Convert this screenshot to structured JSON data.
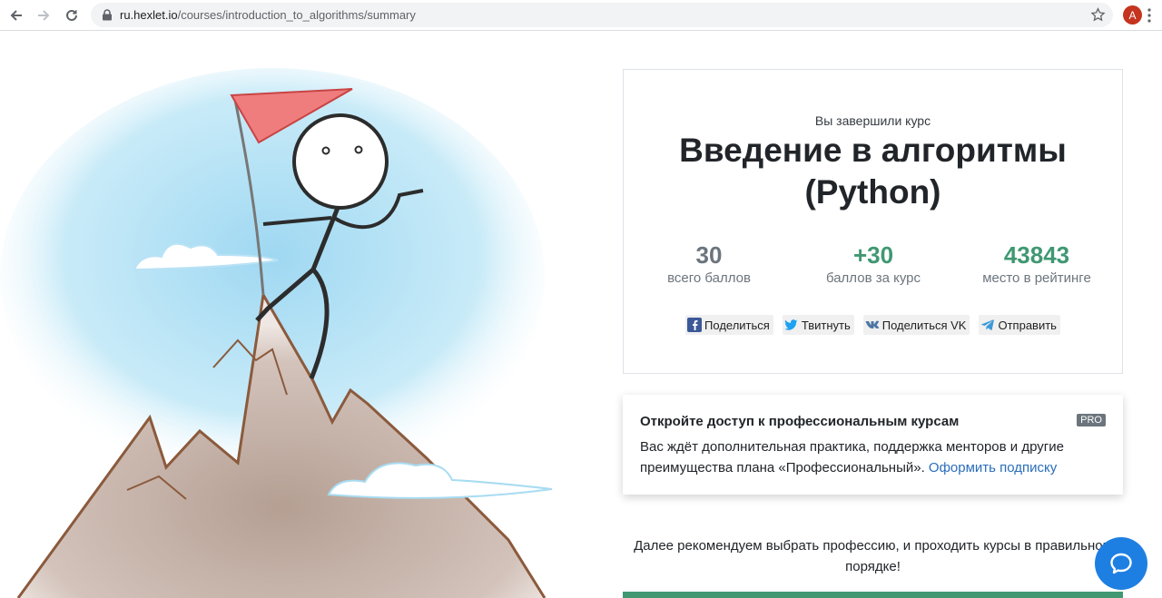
{
  "browser": {
    "url_host": "ru.hexlet.io",
    "url_path": "/courses/introduction_to_algorithms/summary",
    "avatar_letter": "A"
  },
  "summary": {
    "completed_label": "Вы завершили курс",
    "course_title": "Введение в алгоритмы (Python)",
    "stats": [
      {
        "value": "30",
        "label": "всего баллов",
        "color": "#6c757d"
      },
      {
        "value": "+30",
        "label": "баллов за курс",
        "color": "#3f9872"
      },
      {
        "value": "43843",
        "label": "место в рейтинге",
        "color": "#3f9872"
      }
    ],
    "share": {
      "facebook": "Поделиться",
      "twitter": "Твитнуть",
      "vk": "Поделиться VK",
      "telegram": "Отправить"
    }
  },
  "pro": {
    "title": "Откройте доступ к профессиональным курсам",
    "badge": "PRO",
    "text": "Вас ждёт дополнительная практика, поддержка менторов и другие преимущества плана «Профессиональный».",
    "link": "Оформить подписку"
  },
  "recommend": {
    "text": "Далее рекомендуем выбрать профессию, и проходить курсы в правильном порядке!"
  },
  "colors": {
    "accent_green": "#3f9872",
    "link_blue": "#2a6ebb",
    "chat_blue": "#1d7fe2"
  }
}
